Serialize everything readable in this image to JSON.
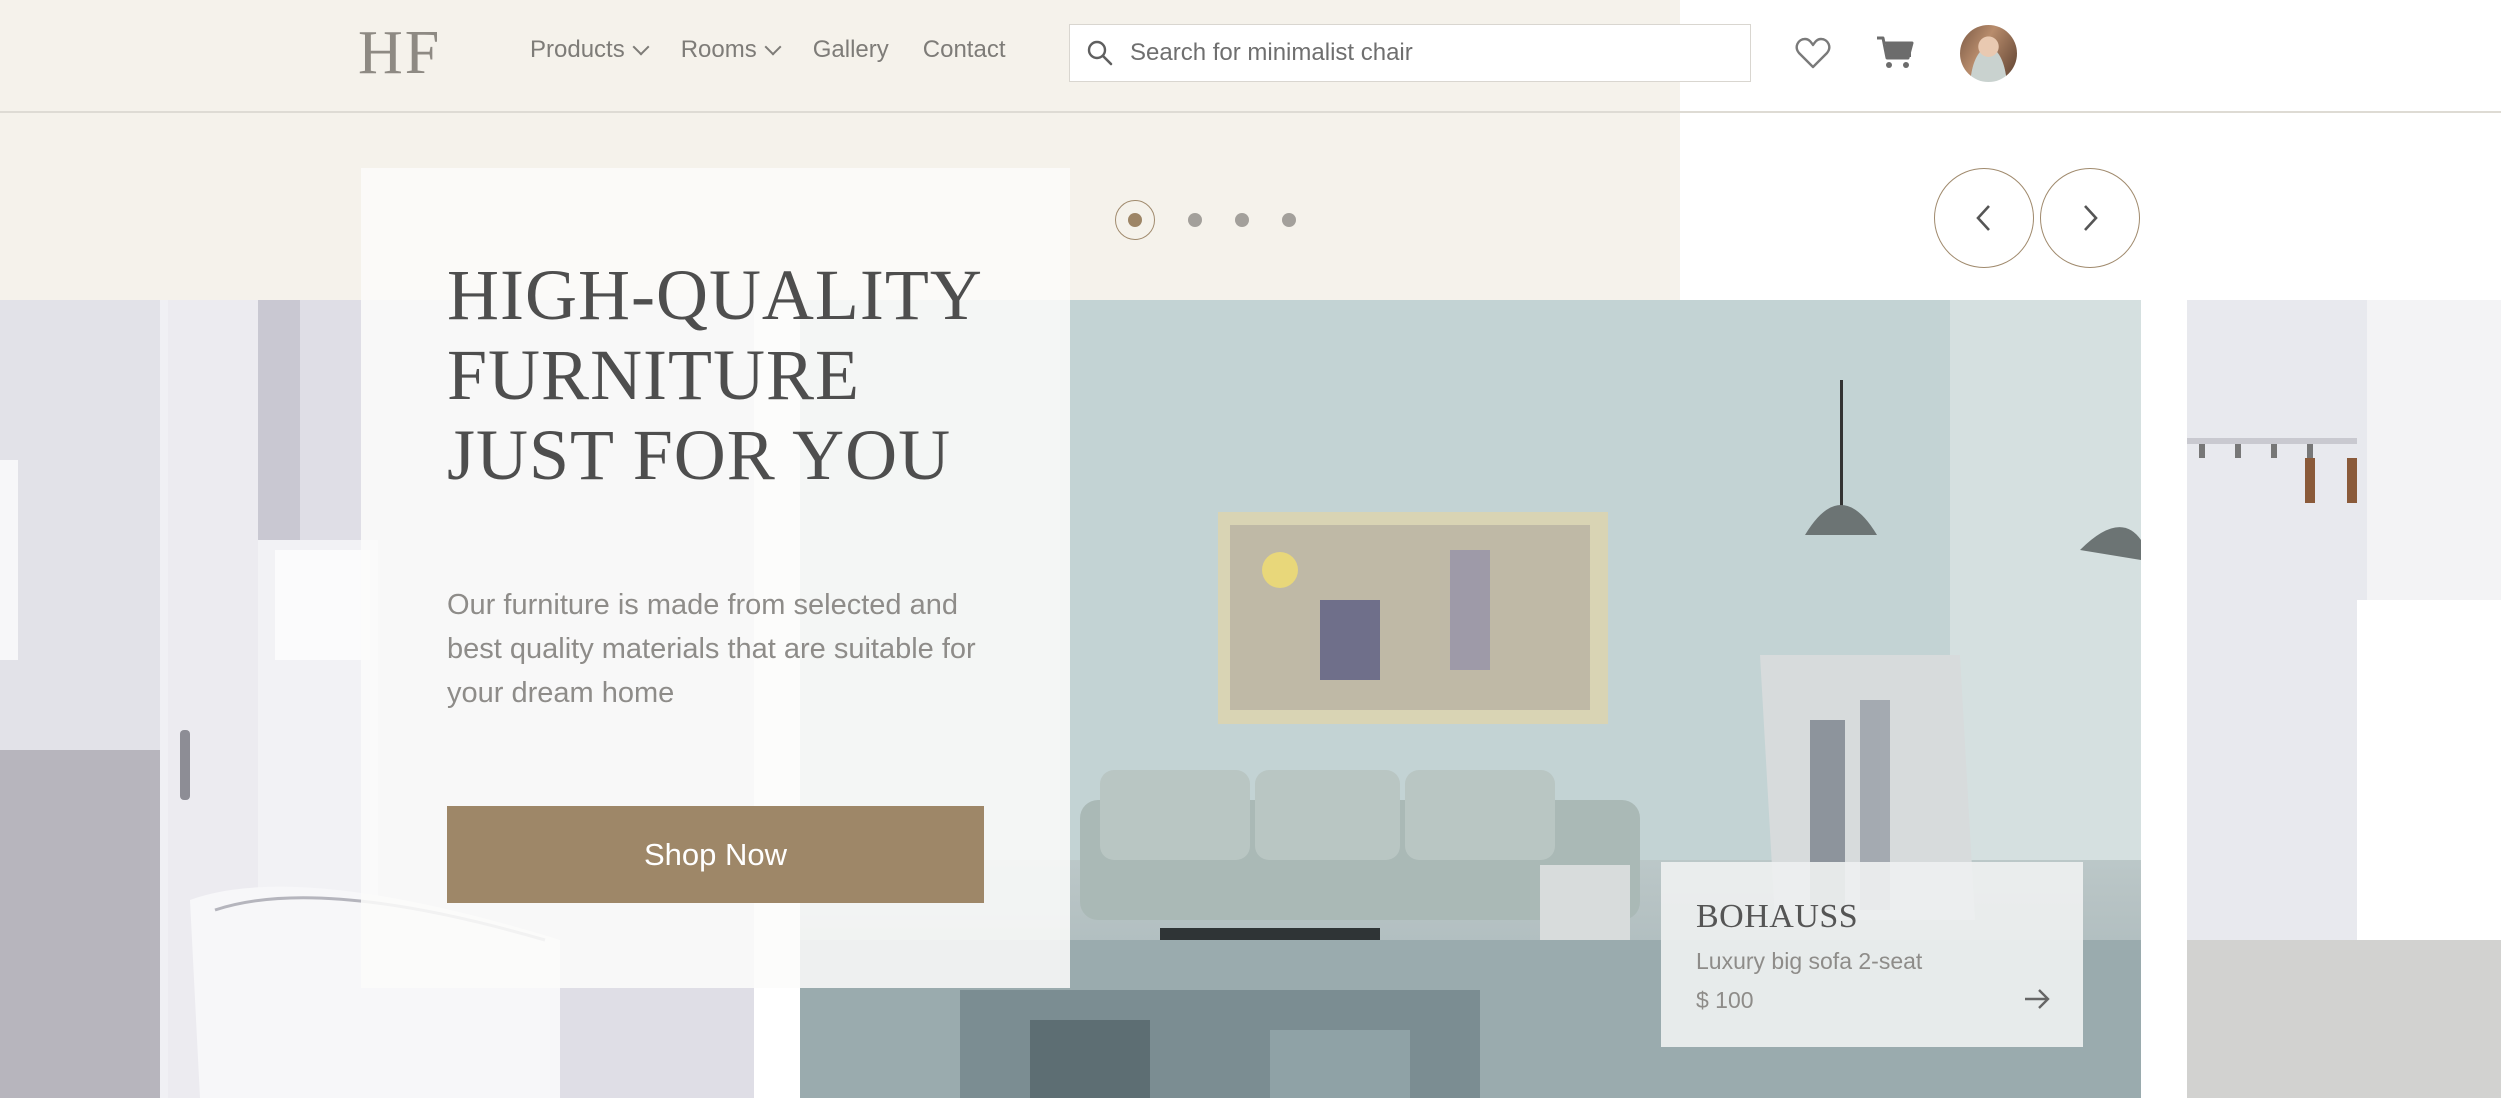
{
  "brand": {
    "logo_text": "HF"
  },
  "nav": {
    "items": [
      {
        "label": "Products",
        "has_dropdown": true
      },
      {
        "label": "Rooms",
        "has_dropdown": true
      },
      {
        "label": "Gallery",
        "has_dropdown": false
      },
      {
        "label": "Contact",
        "has_dropdown": false
      }
    ]
  },
  "search": {
    "placeholder": "Search for minimalist chair",
    "icon": "search-icon"
  },
  "header_icons": {
    "wishlist": "heart-icon",
    "cart": "cart-icon",
    "account": "avatar"
  },
  "carousel": {
    "slide_count": 4,
    "active_index": 0
  },
  "hero": {
    "title_lines": [
      "HIGH-QUALITY",
      "FURNITURE",
      "JUST FOR YOU"
    ],
    "description": "Our furniture is made from selected and best quality materials that are suitable for your dream home",
    "cta_label": "Shop Now"
  },
  "product_card": {
    "title": "BOHAUSS",
    "subtitle": "Luxury big sofa 2-seat",
    "price": "$ 100"
  },
  "colors": {
    "beige_background": "#f5f2eb",
    "accent_brown": "#9e8768",
    "text_dark": "#4e4e4e",
    "text_muted": "#8e8c89"
  }
}
